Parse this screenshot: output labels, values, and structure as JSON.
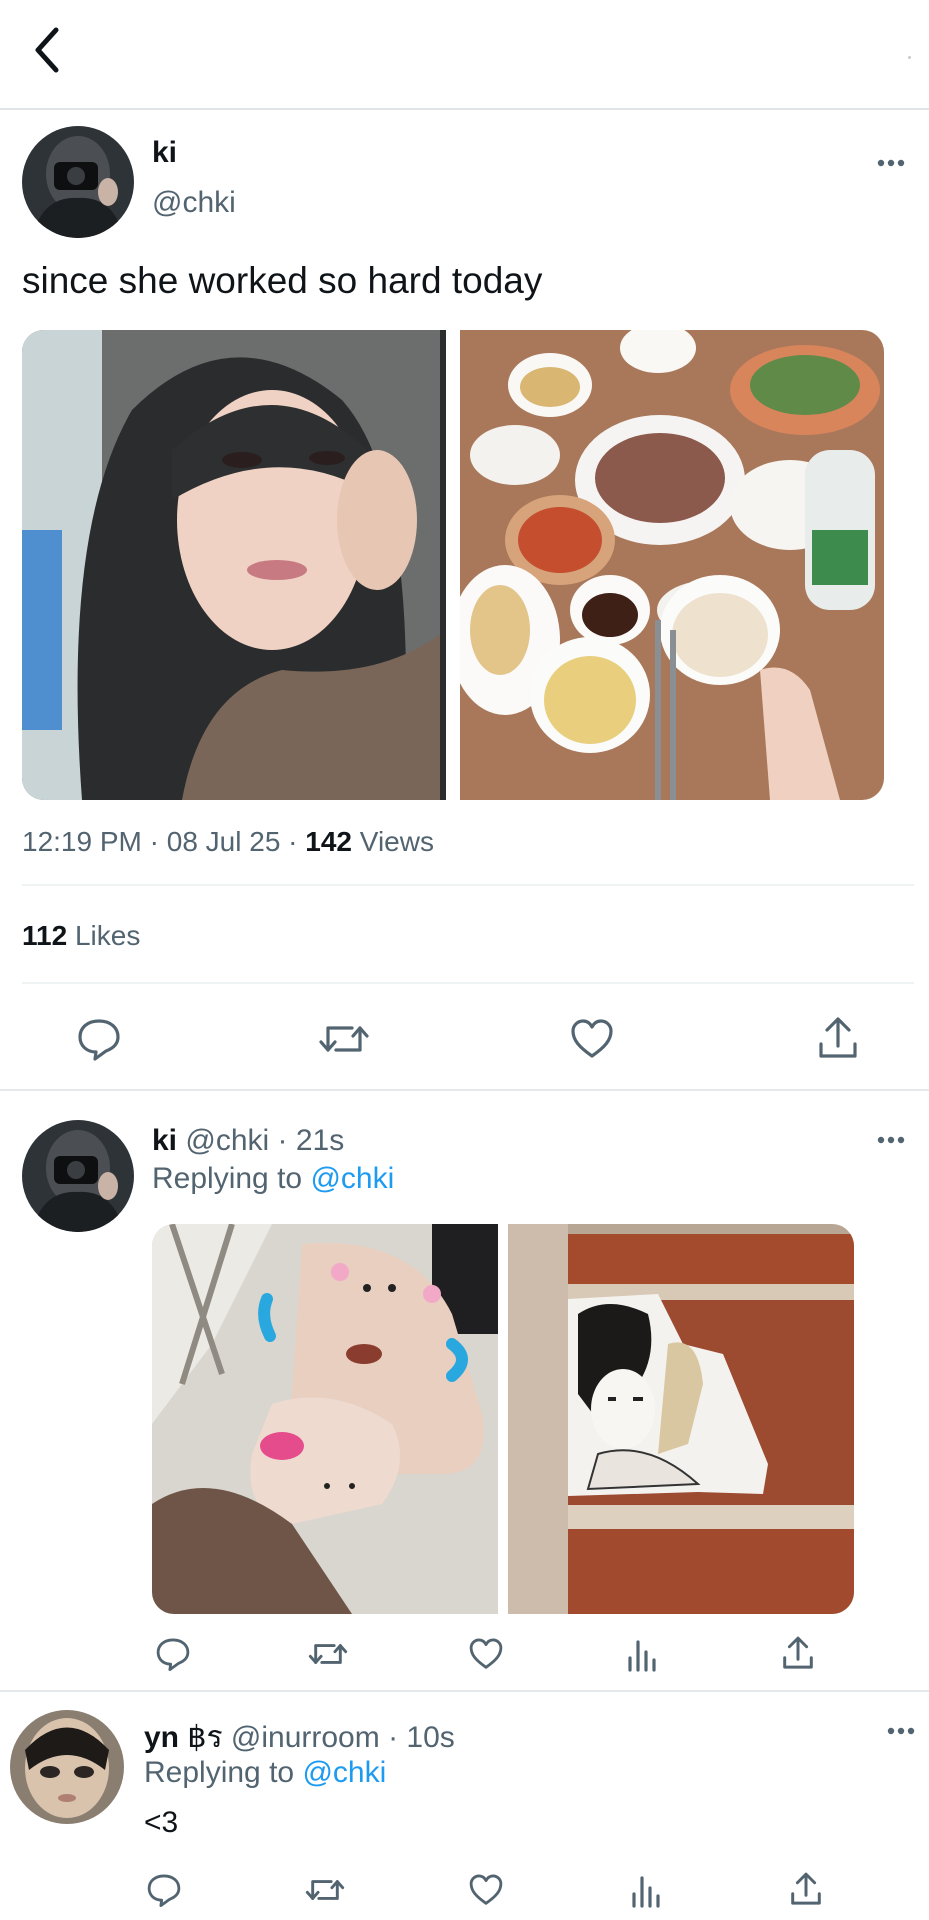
{
  "tweet": {
    "name": "ki",
    "handle": "@chki",
    "text": "since she worked so hard today",
    "time": "12:19 PM",
    "date": "08 Jul 25",
    "views_count": "142",
    "views_label": "Views",
    "likes_count": "112",
    "likes_label": "Likes"
  },
  "reply1": {
    "name": "ki",
    "handle_time": "@chki · 21s",
    "replying_prefix": "Replying to",
    "replying_to": "@chki"
  },
  "reply2": {
    "name": "yn",
    "name_emoji": "฿ร",
    "handle_time": "@inurroom · 10s",
    "replying_prefix": "Replying to",
    "replying_to": "@chki",
    "text": "<3"
  },
  "separators": {
    "dot": "·"
  },
  "icons": [
    "back-icon",
    "more-icon",
    "reply-icon",
    "retweet-icon",
    "like-icon",
    "share-icon",
    "views-icon"
  ],
  "colors": {
    "link": "#1d9bf0",
    "secondary": "#536471",
    "text": "#0f1419",
    "icon": "#536471"
  }
}
